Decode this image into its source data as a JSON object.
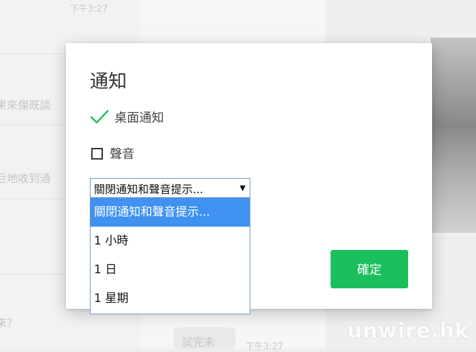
{
  "background": {
    "times": [
      "下午3:27",
      "下午3:27"
    ],
    "fragments": [
      "果來傑既談",
      "巨地收到通",
      "來？",
      "試完未"
    ]
  },
  "modal": {
    "title": "通知",
    "desktop_notification": {
      "label": "桌面通知",
      "checked": true
    },
    "sound": {
      "label": "聲音",
      "checked": false
    },
    "mute_select": {
      "value": "關閉通知和聲音提示...",
      "options": [
        "關閉通知和聲音提示...",
        "1 小時",
        "1 日",
        "1 星期"
      ],
      "selected_index": 0
    },
    "confirm_label": "確定"
  },
  "colors": {
    "accent_green": "#1bbf5b",
    "selected_option": "#3f92f0",
    "check_green": "#1bbf5b"
  },
  "watermark": "unwire.hk"
}
